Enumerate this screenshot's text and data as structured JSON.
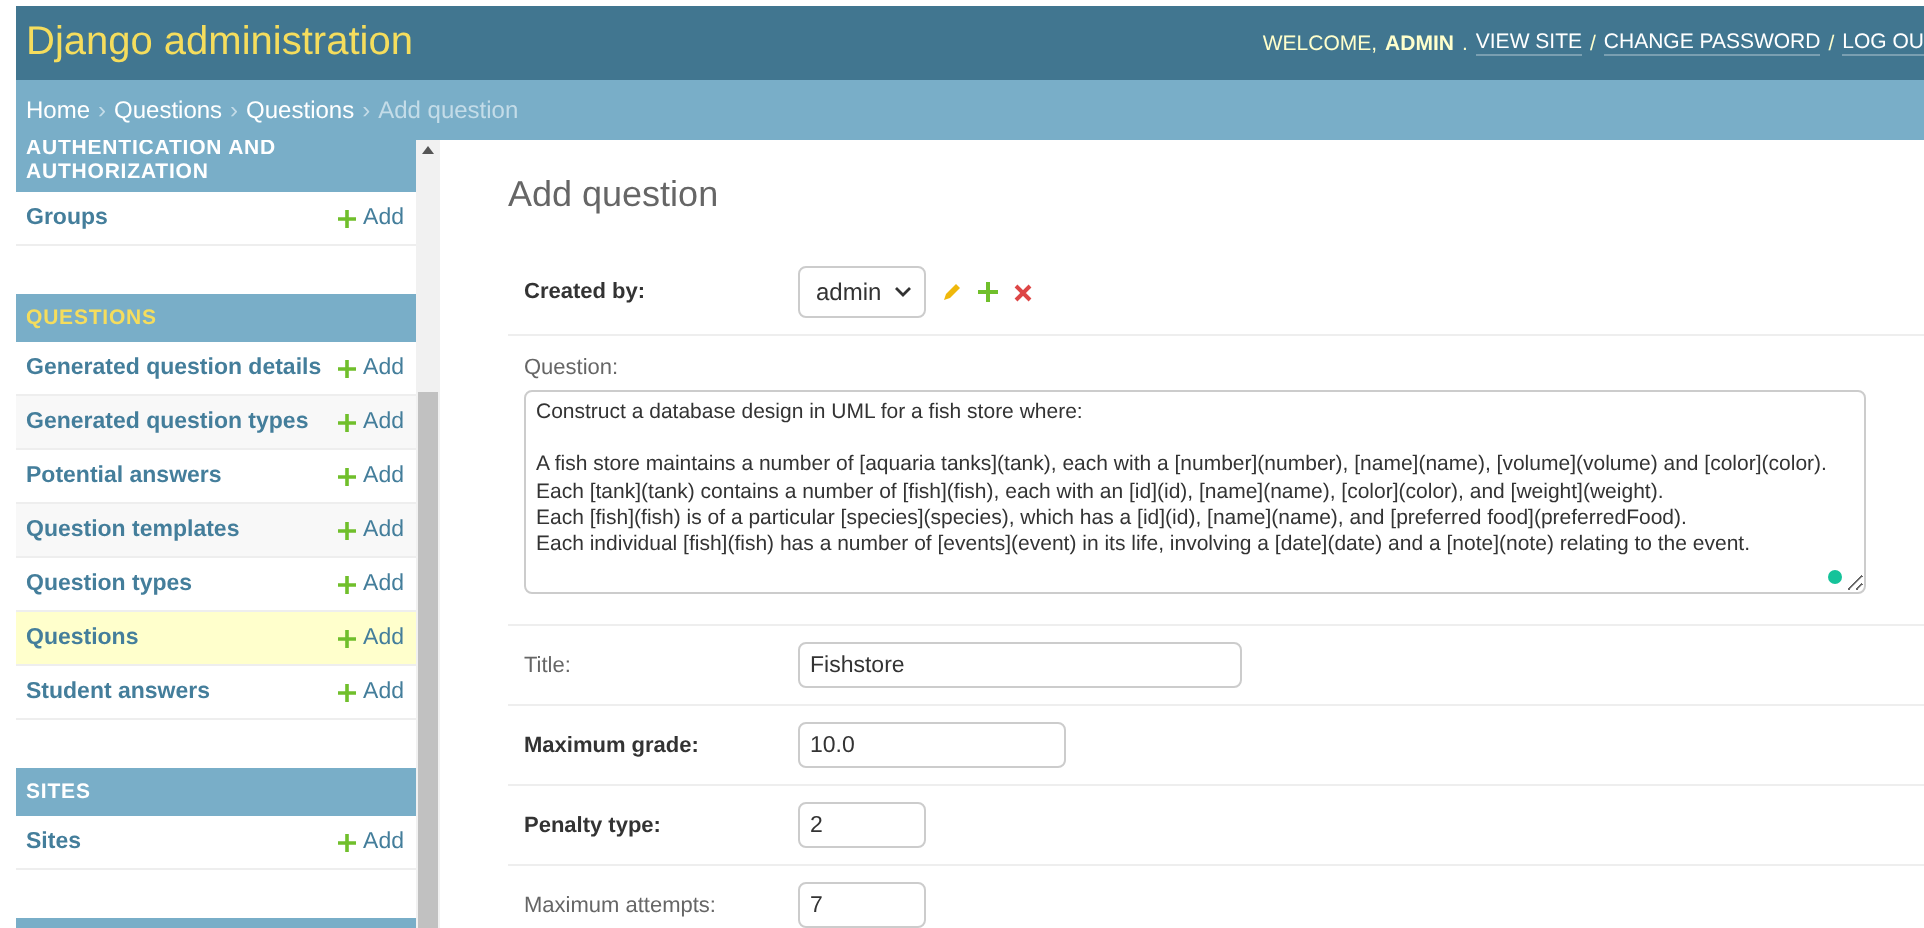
{
  "header": {
    "brand": "Django administration",
    "welcome": "WELCOME,",
    "user": "ADMIN",
    "separator": ".",
    "link_separator": "/",
    "links": [
      "VIEW SITE",
      "CHANGE PASSWORD",
      "LOG OU"
    ]
  },
  "breadcrumbs": {
    "links": [
      "Home",
      "Questions",
      "Questions"
    ],
    "current": "Add question",
    "separator": "›"
  },
  "sidebar": {
    "modules": [
      {
        "caption": "AUTHENTICATION AND AUTHORIZATION",
        "models": [
          {
            "name": "Groups",
            "add": "Add",
            "selected": false
          }
        ]
      },
      {
        "caption": "QUESTIONS",
        "models": [
          {
            "name": "Generated question details",
            "add": "Add",
            "selected": false
          },
          {
            "name": "Generated question types",
            "add": "Add",
            "selected": false
          },
          {
            "name": "Potential answers",
            "add": "Add",
            "selected": false
          },
          {
            "name": "Question templates",
            "add": "Add",
            "selected": false
          },
          {
            "name": "Question types",
            "add": "Add",
            "selected": false
          },
          {
            "name": "Questions",
            "add": "Add",
            "selected": true
          },
          {
            "name": "Student answers",
            "add": "Add",
            "selected": false
          }
        ]
      },
      {
        "caption": "SITES",
        "models": [
          {
            "name": "Sites",
            "add": "Add",
            "selected": false
          }
        ]
      }
    ]
  },
  "page_title": "Add question",
  "form": [
    {
      "kind": "select",
      "label": "Created by:",
      "required": true,
      "value": "admin"
    },
    {
      "kind": "textarea",
      "label": "Question:",
      "required": false,
      "value": "Construct a database design in UML for a fish store where:\n\nA fish store maintains a number of [aquaria tanks](tank), each with a [number](number), [name](name), [volume](volume) and [color](color).\nEach [tank](tank) contains a number of [fish](fish), each with an [id](id), [name](name), [color](color), and [weight](weight).\nEach [fish](fish) is of a particular [species](species), which has a [id](id), [name](name), and [preferred food](preferredFood).\nEach individual [fish](fish) has a number of [events](event) in its life, involving a [date](date) and a [note](note) relating to the event."
    },
    {
      "kind": "text",
      "label": "Title:",
      "required": false,
      "value": "Fishstore"
    },
    {
      "kind": "number",
      "label": "Maximum grade:",
      "required": true,
      "value": "10.0"
    },
    {
      "kind": "short",
      "label": "Penalty type:",
      "required": true,
      "value": "2"
    },
    {
      "kind": "short",
      "label": "Maximum attempts:",
      "required": false,
      "value": "7"
    }
  ]
}
